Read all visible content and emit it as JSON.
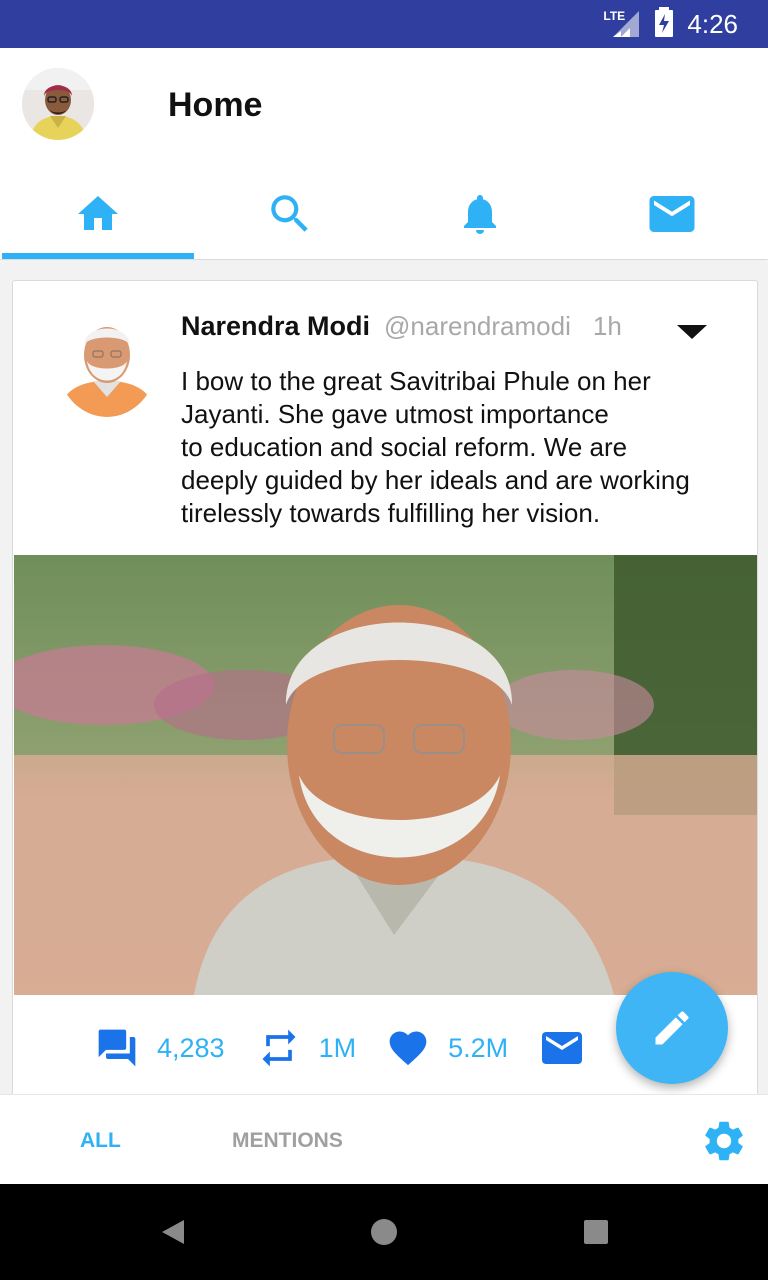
{
  "status_bar": {
    "time": "4:26",
    "network": "LTE",
    "icons": [
      "signal-icon",
      "battery-charging-icon"
    ]
  },
  "app_bar": {
    "title": "Home",
    "avatar": "profile-avatar"
  },
  "tabs": [
    {
      "icon": "home-icon",
      "selected": true
    },
    {
      "icon": "search-icon",
      "selected": false
    },
    {
      "icon": "bell-icon",
      "selected": false
    },
    {
      "icon": "mail-icon",
      "selected": false
    }
  ],
  "tweet": {
    "author_name": "Narendra Modi",
    "author_handle": "@narendramodi",
    "time": "1h",
    "text_lines": [
      "I bow to the great Savitribai Phule on her",
      "Jayanti. She gave utmost importance",
      "to education and social reform. We are",
      "deeply guided by her ideals and are working",
      "tirelessly towards fulfilling her vision."
    ],
    "actions": {
      "replies": "4,283",
      "retweets": "1M",
      "likes": "5.2M"
    }
  },
  "bottom_tabs": {
    "all": "ALL",
    "mentions": "MENTIONS"
  },
  "colors": {
    "accent": "#2fb2f5",
    "status_bar": "#303f9f",
    "action_blue": "#1a73e8"
  }
}
